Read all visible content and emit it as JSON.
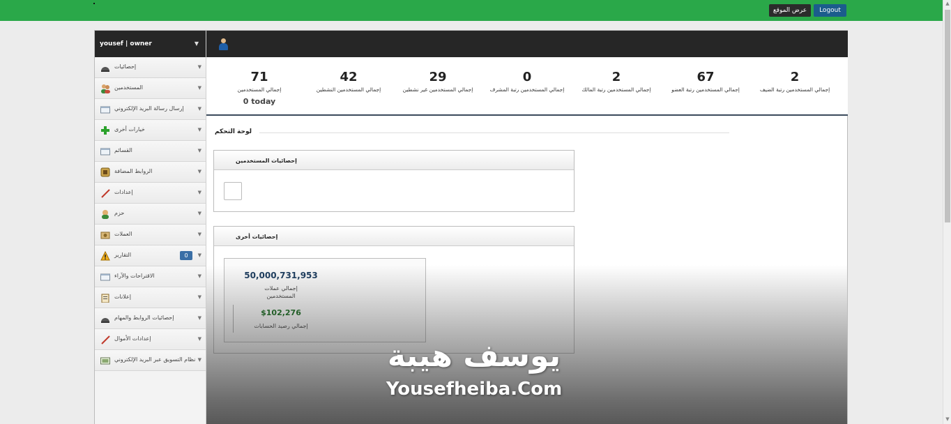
{
  "topbar": {
    "view_site_label": "عرض الموقع",
    "logout_label": "Logout",
    "brand_color": "#2aa849"
  },
  "sidebar": {
    "user": "yousef | owner",
    "items": [
      {
        "label": "إحصائيات",
        "icon": "dashboard-icon"
      },
      {
        "label": "المستخدمين",
        "icon": "users-icon"
      },
      {
        "label": "إرسال رسالة البريد الإلكتروني",
        "icon": "mail-window-icon"
      },
      {
        "label": "خيارات أخرى",
        "icon": "plus-icon"
      },
      {
        "label": "القسائم",
        "icon": "coupon-window-icon"
      },
      {
        "label": "الروابط المضافة",
        "icon": "links-icon"
      },
      {
        "label": "إعدادات",
        "icon": "settings-pen-icon"
      },
      {
        "label": "حزم",
        "icon": "packages-icon"
      },
      {
        "label": "العملات",
        "icon": "currency-icon"
      },
      {
        "label": "التقارير",
        "icon": "warning-icon",
        "badge": "0"
      },
      {
        "label": "الاقتراحات والآراء",
        "icon": "feedback-window-icon"
      },
      {
        "label": "إعلانات",
        "icon": "ads-clipboard-icon"
      },
      {
        "label": "إحصائيات الروابط والمهام",
        "icon": "dashboard-icon"
      },
      {
        "label": "إعدادات الأموال",
        "icon": "money-pen-icon"
      },
      {
        "label": "نظام التسويق عبر البريد الإلكتروني",
        "icon": "email-marketing-icon"
      }
    ]
  },
  "stats": [
    {
      "value": "71",
      "caption": "إجمالي المستخدمين",
      "sub": "0 today"
    },
    {
      "value": "42",
      "caption": "إجمالي المستخدمين النشطين"
    },
    {
      "value": "29",
      "caption": "إجمالي المستخدمين غير نشطين"
    },
    {
      "value": "0",
      "caption": "إجمالي المستخدمين رتبة المشرف"
    },
    {
      "value": "2",
      "caption": "إجمالي المستخدمين رتبة المالك"
    },
    {
      "value": "67",
      "caption": "إجمالي المستخدمين رتبة العضو"
    },
    {
      "value": "2",
      "caption": "إجمالي المستخدمين رتبة الضيف"
    }
  ],
  "dashboard": {
    "title": "لوحة التحكم",
    "user_stats_panel": "إحصائيات المستخدمين",
    "other_stats_panel": "إحصائيات أخرى",
    "total_currency_value": "50,000,731,953",
    "total_currency_label_line1": "إجمالي عملات",
    "total_currency_label_line2": "المستخدمين",
    "total_balance_value": "$102,276",
    "total_balance_label": "إجمالي رصيد الحسابات"
  },
  "watermark": {
    "arabic": "يوسف هيبة",
    "latin": "Yousefheiba.Com"
  }
}
